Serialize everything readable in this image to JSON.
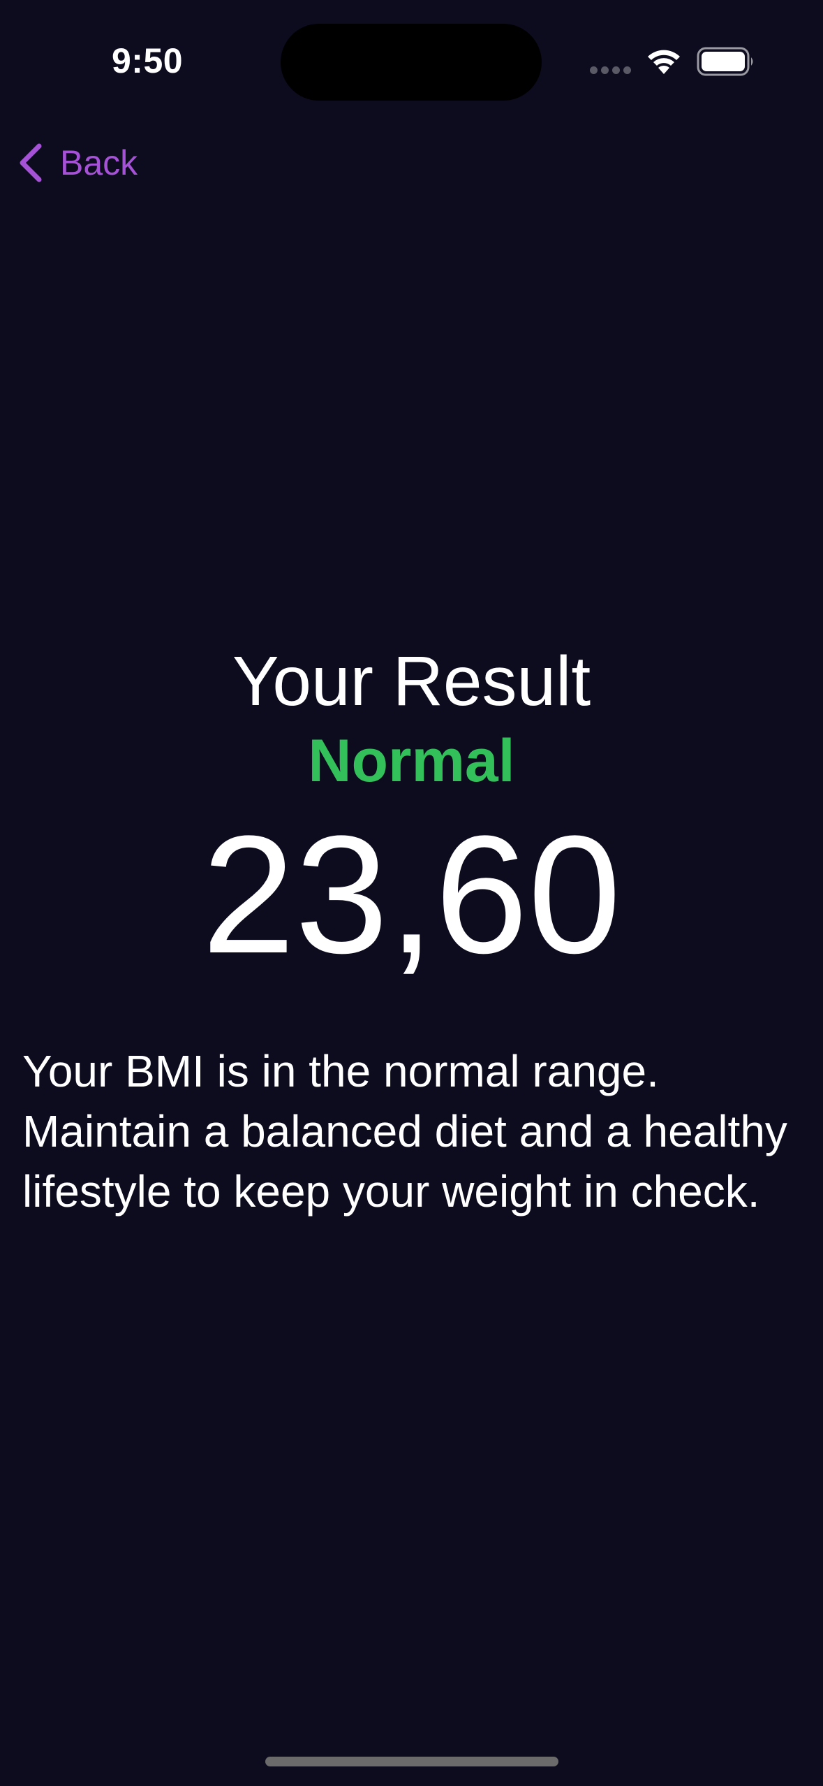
{
  "status_bar": {
    "time": "9:50"
  },
  "nav": {
    "back_label": "Back"
  },
  "result": {
    "title": "Your Result",
    "category": "Normal",
    "bmi_value": "23,60",
    "advice": "Your BMI is in the normal range. Maintain a balanced diet and a healthy lifestyle to keep your weight in check."
  },
  "colors": {
    "background": "#0d0b1e",
    "accent": "#a652d6",
    "category_normal": "#33c05a",
    "text": "#ffffff"
  },
  "icons": {
    "back": "chevron-left-icon",
    "wifi": "wifi-icon",
    "battery": "battery-icon",
    "signal": "cellular-signal-icon"
  }
}
